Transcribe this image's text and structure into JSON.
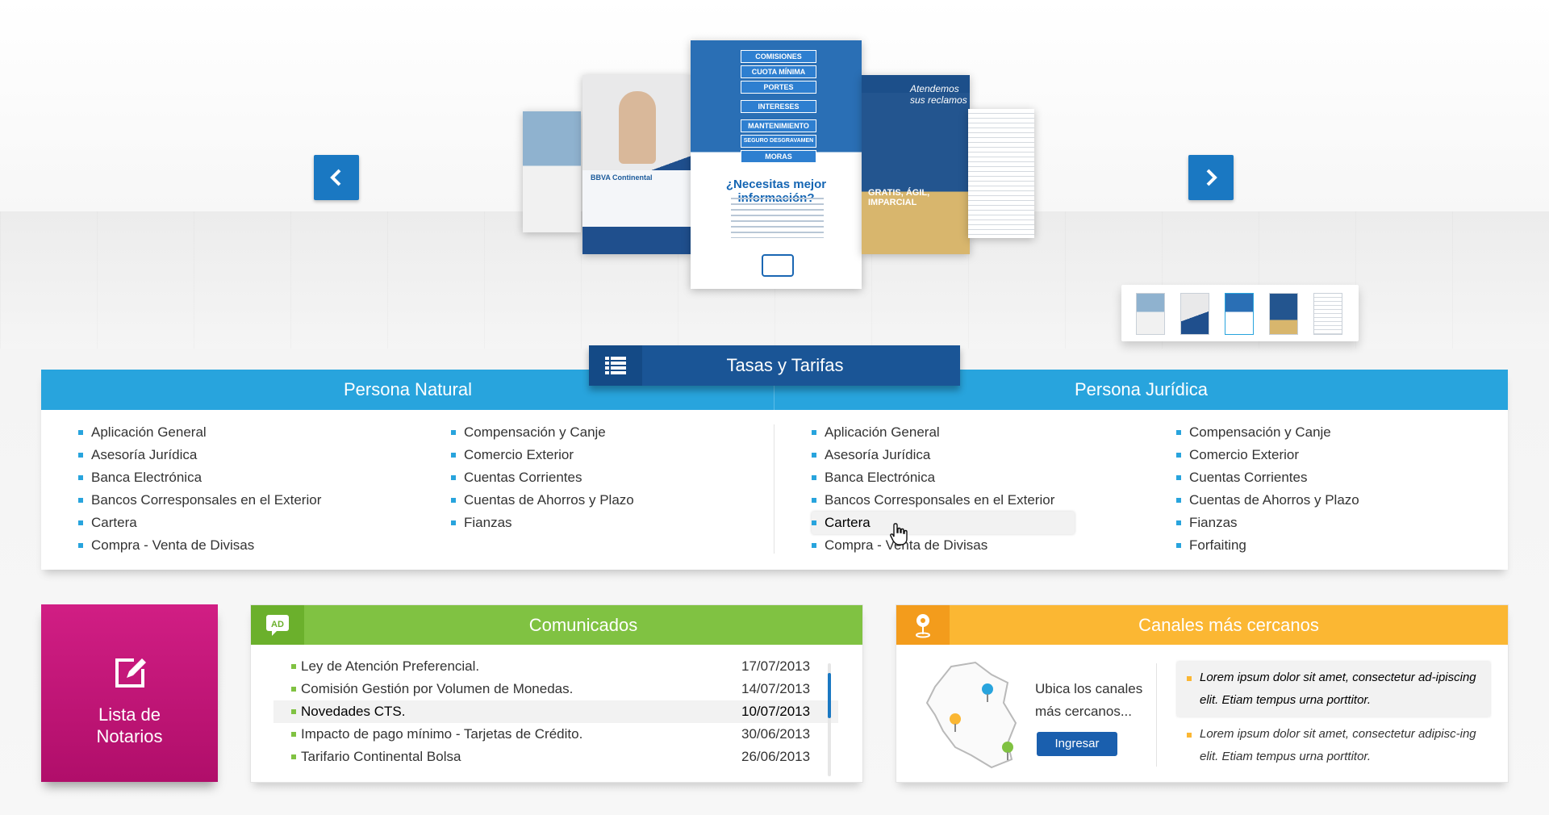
{
  "carousel": {
    "prev_icon": "chevron-left-icon",
    "next_icon": "chevron-right-icon",
    "featured": {
      "signs": [
        "COMISIONES",
        "CUOTA MÍNIMA",
        "PORTES",
        "INTERESES",
        "MANTENIMIENTO",
        "SEGURO DESGRAVAMEN",
        "MORAS"
      ],
      "headline": "¿Necesitas mejor información?"
    },
    "left_doc_text": "BBVA Continental",
    "right_doc_heading": "Atendemos sus reclamos",
    "right_doc_text": "GRATIS, ÁGIL, IMPARCIAL",
    "thumbnail_count": 5
  },
  "tasas": {
    "icon": "list-icon",
    "label": "Tasas y Tarifas",
    "persona_natural": {
      "title": "Persona Natural",
      "col1": [
        "Aplicación General",
        "Asesoría Jurídica",
        "Banca Electrónica",
        "Bancos Corresponsales en el Exterior",
        "Cartera",
        "Compra - Venta de Divisas"
      ],
      "col2": [
        "Compensación y Canje",
        "Comercio Exterior",
        "Cuentas Corrientes",
        "Cuentas de Ahorros y Plazo",
        "Fianzas"
      ]
    },
    "persona_juridica": {
      "title": "Persona Jurídica",
      "col1": [
        "Aplicación General",
        "Asesoría Jurídica",
        "Banca Electrónica",
        "Bancos Corresponsales en el Exterior",
        "Cartera",
        "Compra - Venta de Divisas"
      ],
      "col2": [
        "Compensación y Canje",
        "Comercio Exterior",
        "Cuentas Corrientes",
        "Cuentas de Ahorros y Plazo",
        "Fianzas",
        "Forfaiting"
      ],
      "highlighted": "Cartera"
    }
  },
  "notarios": {
    "icon": "edit-icon",
    "label_line1": "Lista de",
    "label_line2": "Notarios"
  },
  "comunicados": {
    "icon": "ad-icon",
    "title": "Comunicados",
    "items": [
      {
        "name": "Ley de Atención Preferencial.",
        "date": "17/07/2013"
      },
      {
        "name": "Comisión Gestión por Volumen de Monedas.",
        "date": "14/07/2013"
      },
      {
        "name": "Novedades CTS.",
        "date": "10/07/2013"
      },
      {
        "name": "Impacto de pago mínimo - Tarjetas de Crédito.",
        "date": "30/06/2013"
      },
      {
        "name": "Tarifario Continental Bolsa",
        "date": "26/06/2013"
      }
    ],
    "highlighted_index": 2
  },
  "canales": {
    "icon": "map-pin-icon",
    "title": "Canales más cercanos",
    "description": "Ubica los canales más cercanos...",
    "button": "Ingresar",
    "notes": [
      "Lorem ipsum dolor sit amet, consectetur ad-ipiscing elit. Etiam tempus urna porttitor.",
      "Lorem ipsum dolor sit amet, consectetur adipisc-ing elit. Etiam tempus urna porttitor."
    ]
  },
  "colors": {
    "blue_header": "#28a4dd",
    "dark_blue": "#1a5596",
    "magenta": "#c4127a",
    "green": "#80c242",
    "orange": "#fbb733"
  }
}
